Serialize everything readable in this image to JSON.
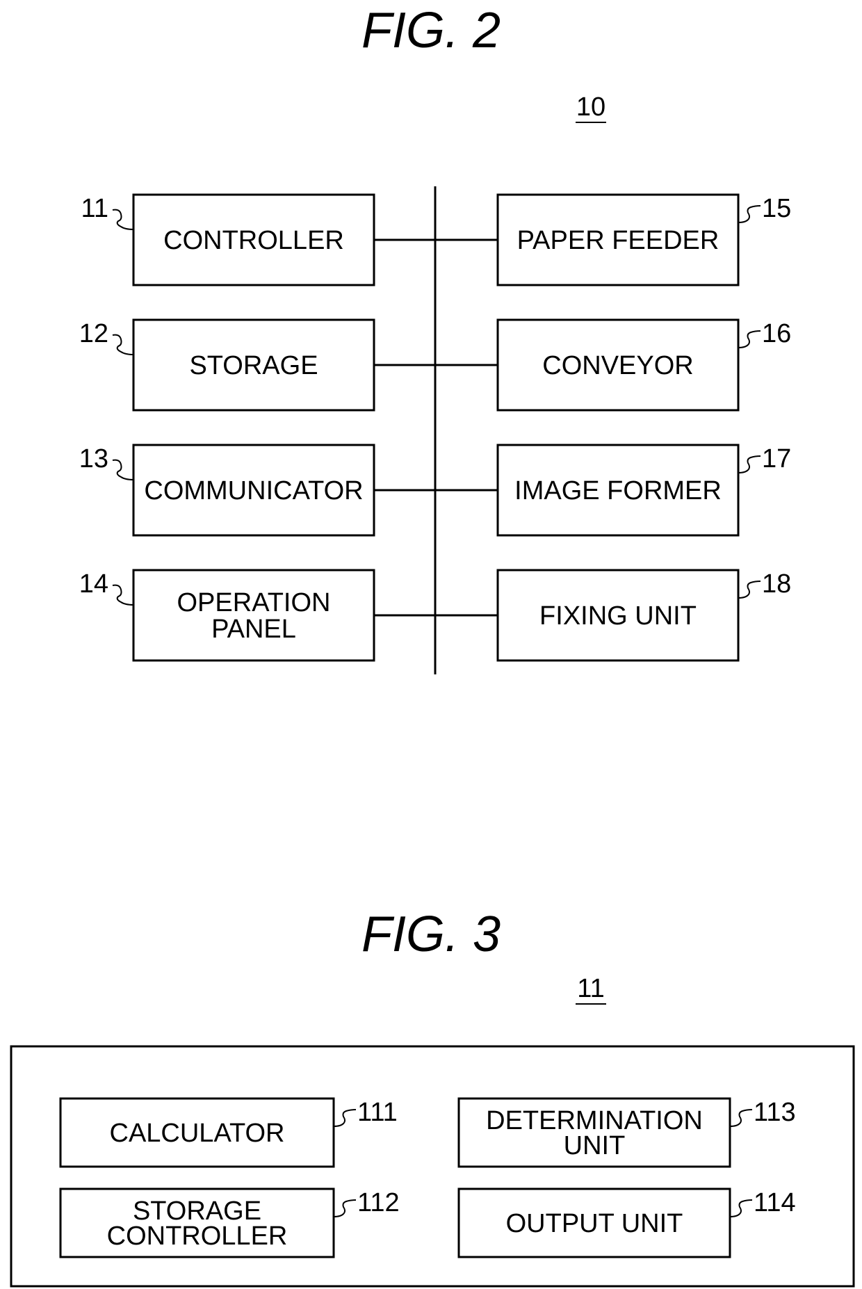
{
  "fig2": {
    "title": "FIG. 2",
    "ref": "10",
    "left_blocks": [
      {
        "ref": "11",
        "lines": [
          "CONTROLLER"
        ]
      },
      {
        "ref": "12",
        "lines": [
          "STORAGE"
        ]
      },
      {
        "ref": "13",
        "lines": [
          "COMMUNICATOR"
        ]
      },
      {
        "ref": "14",
        "lines": [
          "OPERATION",
          "PANEL"
        ]
      }
    ],
    "right_blocks": [
      {
        "ref": "15",
        "lines": [
          "PAPER FEEDER"
        ]
      },
      {
        "ref": "16",
        "lines": [
          "CONVEYOR"
        ]
      },
      {
        "ref": "17",
        "lines": [
          "IMAGE FORMER"
        ]
      },
      {
        "ref": "18",
        "lines": [
          "FIXING UNIT"
        ]
      }
    ]
  },
  "fig3": {
    "title": "FIG. 3",
    "ref": "11",
    "left_blocks": [
      {
        "ref": "111",
        "lines": [
          "CALCULATOR"
        ]
      },
      {
        "ref": "112",
        "lines": [
          "STORAGE",
          "CONTROLLER"
        ]
      }
    ],
    "right_blocks": [
      {
        "ref": "113",
        "lines": [
          "DETERMINATION",
          "UNIT"
        ]
      },
      {
        "ref": "114",
        "lines": [
          "OUTPUT UNIT"
        ]
      }
    ]
  }
}
